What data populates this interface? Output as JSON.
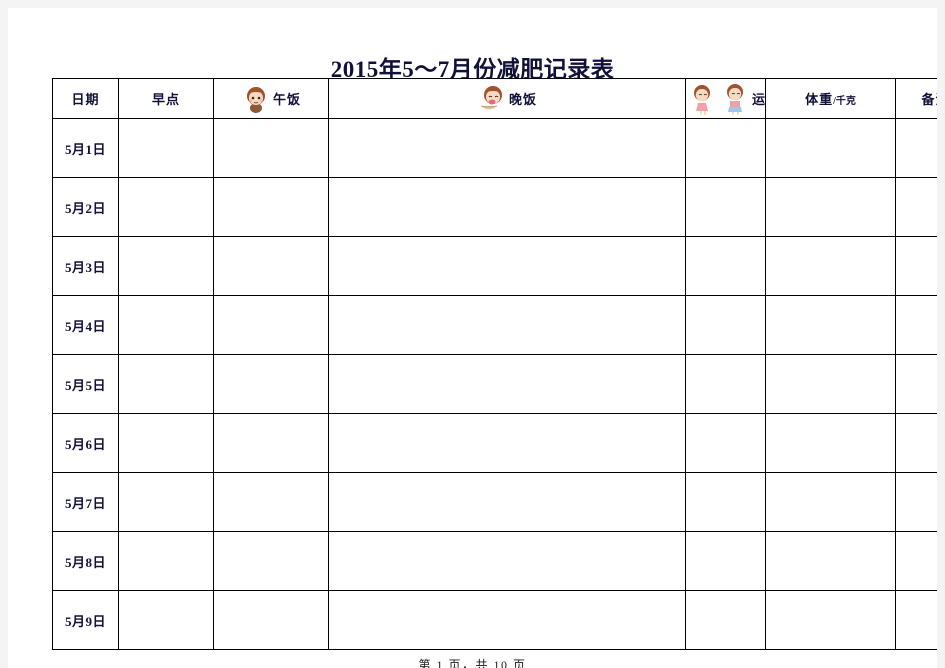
{
  "document": {
    "title": "2015年5～7月份减肥记录表",
    "footer": "第 1 页，共 10 页"
  },
  "table": {
    "columns": [
      {
        "key": "date",
        "label": "日期",
        "icons": []
      },
      {
        "key": "breakfast",
        "label": "早点",
        "icons": []
      },
      {
        "key": "lunch",
        "label": "午饭",
        "icons": [
          "girl-face-icon"
        ]
      },
      {
        "key": "dinner",
        "label": "晚饭",
        "icons": [
          "girl-eating-bowl-icon"
        ]
      },
      {
        "key": "exercise",
        "label": "运动",
        "icons": [
          "girl-stretch-icon",
          "girl-jump-icon",
          "girl-cheer-icon",
          "girl-wave-icon"
        ]
      },
      {
        "key": "weight",
        "label": "体重",
        "label_suffix": "/千克",
        "icons": []
      },
      {
        "key": "remarks",
        "label": "备注",
        "icons": []
      }
    ],
    "rows": [
      {
        "date": "5月1日",
        "breakfast": "",
        "lunch": "",
        "dinner": "",
        "exercise": "",
        "weight": "",
        "remarks": ""
      },
      {
        "date": "5月2日",
        "breakfast": "",
        "lunch": "",
        "dinner": "",
        "exercise": "",
        "weight": "",
        "remarks": ""
      },
      {
        "date": "5月3日",
        "breakfast": "",
        "lunch": "",
        "dinner": "",
        "exercise": "",
        "weight": "",
        "remarks": ""
      },
      {
        "date": "5月4日",
        "breakfast": "",
        "lunch": "",
        "dinner": "",
        "exercise": "",
        "weight": "",
        "remarks": ""
      },
      {
        "date": "5月5日",
        "breakfast": "",
        "lunch": "",
        "dinner": "",
        "exercise": "",
        "weight": "",
        "remarks": ""
      },
      {
        "date": "5月6日",
        "breakfast": "",
        "lunch": "",
        "dinner": "",
        "exercise": "",
        "weight": "",
        "remarks": ""
      },
      {
        "date": "5月7日",
        "breakfast": "",
        "lunch": "",
        "dinner": "",
        "exercise": "",
        "weight": "",
        "remarks": ""
      },
      {
        "date": "5月8日",
        "breakfast": "",
        "lunch": "",
        "dinner": "",
        "exercise": "",
        "weight": "",
        "remarks": ""
      },
      {
        "date": "5月9日",
        "breakfast": "",
        "lunch": "",
        "dinner": "",
        "exercise": "",
        "weight": "",
        "remarks": ""
      }
    ]
  },
  "colors": {
    "text_dark_navy": "#10103a",
    "page_background": "#ffffff",
    "canvas_background": "#f4f4f4",
    "table_border": "#000000",
    "icon_hair": "#a0522d",
    "icon_skin": "#f7d9c4",
    "icon_dress": "#f2a0a8"
  }
}
